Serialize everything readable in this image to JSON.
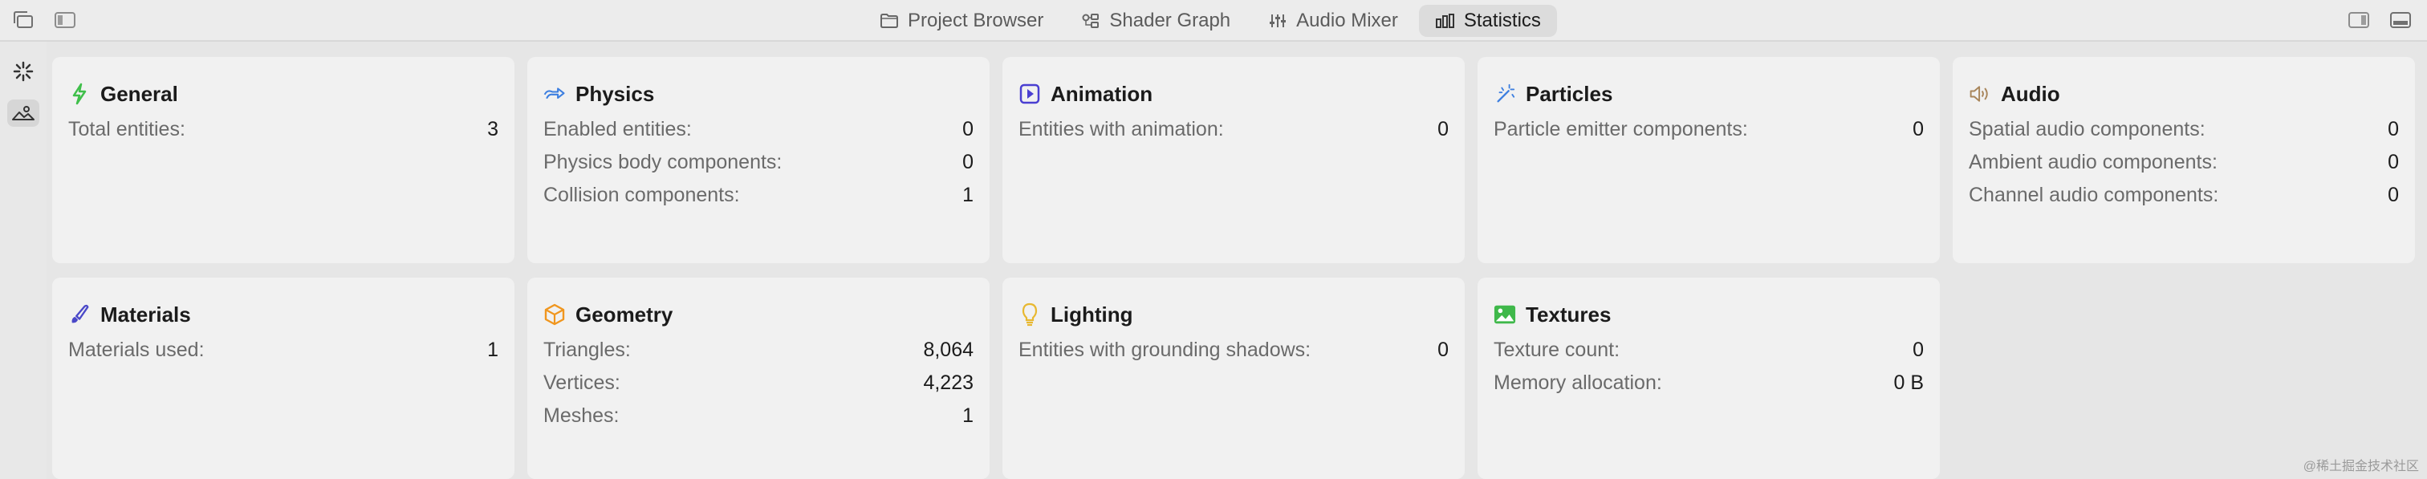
{
  "toolbar": {
    "tabs": [
      {
        "label": "Project Browser",
        "icon": "folder-icon"
      },
      {
        "label": "Shader Graph",
        "icon": "node-graph-icon"
      },
      {
        "label": "Audio Mixer",
        "icon": "sliders-icon"
      },
      {
        "label": "Statistics",
        "icon": "bar-chart-icon",
        "active": true
      }
    ]
  },
  "cards": {
    "general": {
      "title": "General",
      "rows": [
        {
          "label": "Total entities:",
          "value": "3"
        }
      ]
    },
    "physics": {
      "title": "Physics",
      "rows": [
        {
          "label": "Enabled entities:",
          "value": "0"
        },
        {
          "label": "Physics body components:",
          "value": "0"
        },
        {
          "label": "Collision components:",
          "value": "1"
        }
      ]
    },
    "animation": {
      "title": "Animation",
      "rows": [
        {
          "label": "Entities with animation:",
          "value": "0"
        }
      ]
    },
    "particles": {
      "title": "Particles",
      "rows": [
        {
          "label": "Particle emitter components:",
          "value": "0"
        }
      ]
    },
    "audio": {
      "title": "Audio",
      "rows": [
        {
          "label": "Spatial audio components:",
          "value": "0"
        },
        {
          "label": "Ambient audio components:",
          "value": "0"
        },
        {
          "label": "Channel audio components:",
          "value": "0"
        }
      ]
    },
    "materials": {
      "title": "Materials",
      "rows": [
        {
          "label": "Materials used:",
          "value": "1"
        }
      ]
    },
    "geometry": {
      "title": "Geometry",
      "rows": [
        {
          "label": "Triangles:",
          "value": "8,064"
        },
        {
          "label": "Vertices:",
          "value": "4,223"
        },
        {
          "label": "Meshes:",
          "value": "1"
        }
      ]
    },
    "lighting": {
      "title": "Lighting",
      "rows": [
        {
          "label": "Entities with grounding shadows:",
          "value": "0"
        }
      ]
    },
    "textures": {
      "title": "Textures",
      "rows": [
        {
          "label": "Texture count:",
          "value": "0"
        },
        {
          "label": "Memory allocation:",
          "value": "0 B"
        }
      ]
    }
  },
  "colors": {
    "general_icon": "#3fbf4a",
    "physics_icon": "#3d7fe0",
    "animation_icon": "#4a3fd1",
    "particles_icon": "#3d7fe0",
    "audio_icon": "#a8855a",
    "materials_icon": "#4a48c8",
    "geometry_icon": "#f0961e",
    "lighting_icon": "#e8b830",
    "textures_icon": "#3fb84a"
  },
  "watermark": "@稀土掘金技术社区"
}
